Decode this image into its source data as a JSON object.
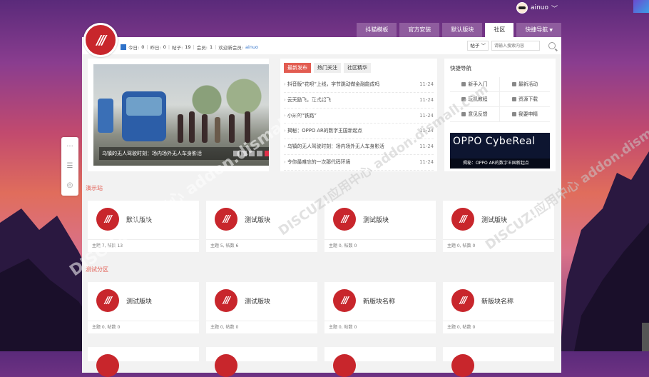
{
  "user": {
    "name": "ainuo"
  },
  "nav": {
    "items": [
      {
        "label": "抖猫模板"
      },
      {
        "label": "官方安装"
      },
      {
        "label": "默认版块"
      },
      {
        "label": "社区",
        "active": true
      },
      {
        "label": "快捷导航"
      }
    ]
  },
  "stats": {
    "today_label": "今日:",
    "today": "0",
    "yesterday_label": "昨日:",
    "yesterday": "0",
    "posts_label": "帖子:",
    "posts": "19",
    "members_label": "会员:",
    "members": "1",
    "welcome_label": "欢迎新会员:",
    "welcome_user": "ainuo"
  },
  "search": {
    "type": "帖子",
    "placeholder": "请输入搜索内容"
  },
  "slider": {
    "caption": "乌镇的无人驾驶时刻：场内场外无人车身影活"
  },
  "news": {
    "tabs": [
      "最新发布",
      "热门关注",
      "社区精华"
    ],
    "items": [
      {
        "title": "抖音版“花呗”上线，字节跳动做金融能成吗",
        "date": "11-24"
      },
      {
        "title": "云天励飞，正式起飞",
        "date": "11-24"
      },
      {
        "title": "小米的“铁路”",
        "date": "11-24"
      },
      {
        "title": "揭秘：OPPO AR的数字王国新起点",
        "date": "11-24"
      },
      {
        "title": "乌镇的无人驾驶时刻：场内场外无人车身影活",
        "date": "11-24"
      },
      {
        "title": "令你最难忘的一次那代码环境",
        "date": "11-24"
      }
    ]
  },
  "quick": {
    "title": "快捷导航",
    "items": [
      "新手入门",
      "最新活动",
      "玩机教程",
      "资源下载",
      "意见反馈",
      "我要申精"
    ],
    "ad_big": "OPPO CybeReal",
    "ad_caption": "揭秘：OPPO AR的数字王国新起点"
  },
  "sections": [
    {
      "title": "演示站",
      "forums": [
        {
          "name": "默认版块",
          "stat": "主题 7, 帖数 13"
        },
        {
          "name": "测试版块",
          "stat": "主题 5, 帖数 6"
        },
        {
          "name": "测试版块",
          "stat": "主题 0, 帖数 0"
        },
        {
          "name": "测试版块",
          "stat": "主题 0, 帖数 0"
        }
      ]
    },
    {
      "title": "测试分区",
      "forums": [
        {
          "name": "测试版块",
          "stat": "主题 0, 帖数 0"
        },
        {
          "name": "测试版块",
          "stat": "主题 0, 帖数 0"
        },
        {
          "name": "新版块名称",
          "stat": "主题 0, 帖数 0"
        },
        {
          "name": "新版块名称",
          "stat": "主题 0, 帖数 0"
        }
      ]
    }
  ],
  "logo_text": "///",
  "watermark": "DISCUZ!应用中心 addon.dismall.com"
}
